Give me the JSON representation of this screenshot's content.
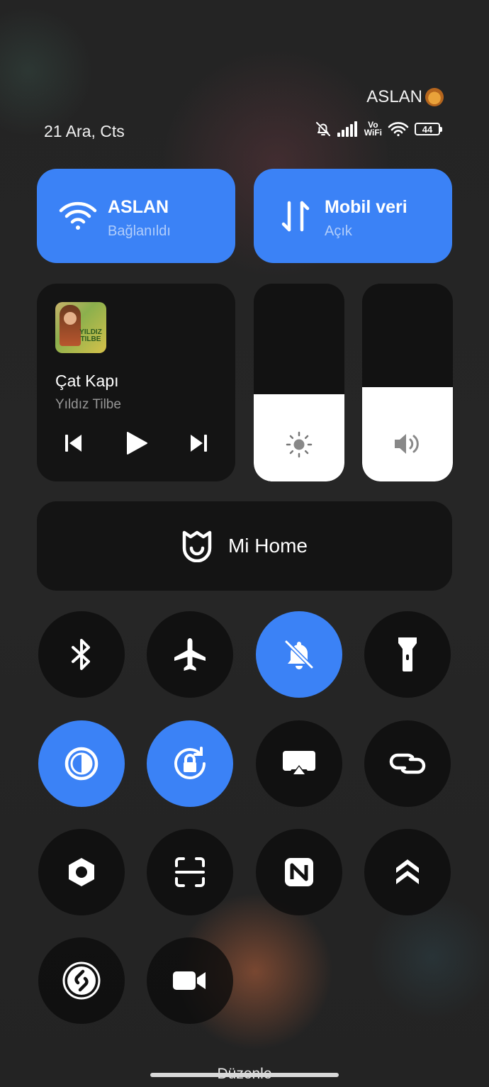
{
  "status": {
    "carrier": "ASLAN",
    "date": "21 Ara, Cts",
    "battery": "44",
    "icons": [
      "bell-off-icon",
      "signal-icon",
      "vowifi-icon",
      "wifi-icon",
      "battery-icon"
    ],
    "vowifi_top": "Vo",
    "vowifi_bottom": "WiFi"
  },
  "tiles": {
    "wifi": {
      "title": "ASLAN",
      "subtitle": "Bağlanıldı",
      "icon": "wifi-icon"
    },
    "mobile": {
      "title": "Mobil veri",
      "subtitle": "Açık",
      "icon": "data-arrows-icon"
    }
  },
  "media": {
    "title": "Çat Kapı",
    "artist": "Yıldız Tilbe",
    "album_text": "YILDIZ TILBE"
  },
  "sliders": {
    "brightness": {
      "icon": "sun-icon",
      "level": 0.44
    },
    "volume": {
      "icon": "speaker-icon",
      "level": 0.475
    }
  },
  "mihome": {
    "label": "Mi Home",
    "icon": "mi-home-icon"
  },
  "toggles": [
    {
      "name": "bluetooth",
      "icon": "bluetooth-icon",
      "on": false
    },
    {
      "name": "airplane",
      "icon": "airplane-icon",
      "on": false
    },
    {
      "name": "mute",
      "icon": "bell-off-icon",
      "on": true
    },
    {
      "name": "flashlight",
      "icon": "flashlight-icon",
      "on": false
    },
    {
      "name": "dark-mode",
      "icon": "contrast-icon",
      "on": true
    },
    {
      "name": "rotation-lock",
      "icon": "rotation-lock-icon",
      "on": true
    },
    {
      "name": "cast",
      "icon": "cast-icon",
      "on": false
    },
    {
      "name": "link",
      "icon": "link-icon",
      "on": false
    },
    {
      "name": "settings",
      "icon": "hexagon-icon",
      "on": false
    },
    {
      "name": "scanner",
      "icon": "scan-icon",
      "on": false
    },
    {
      "name": "nfc",
      "icon": "nfc-icon",
      "on": false
    },
    {
      "name": "power-save",
      "icon": "chevrons-up-icon",
      "on": false
    },
    {
      "name": "shazam",
      "icon": "shazam-icon",
      "on": false
    },
    {
      "name": "screen-record",
      "icon": "video-icon",
      "on": false
    }
  ],
  "footer": {
    "edit_label": "Düzenle"
  },
  "colors": {
    "accent": "#3b82f6",
    "tile_dark": "#0f0f0f"
  }
}
